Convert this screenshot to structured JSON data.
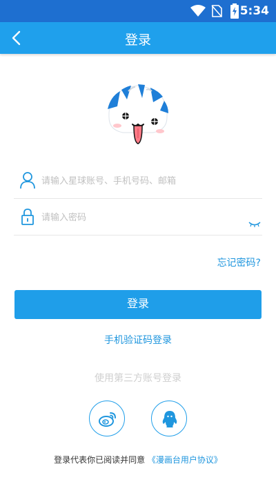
{
  "status_bar": {
    "time": "5:34"
  },
  "app_bar": {
    "title": "登录"
  },
  "form": {
    "account_placeholder": "请输入星球账号、手机号码、邮箱",
    "password_placeholder": "请输入密码",
    "forgot_label": "忘记密码?",
    "login_label": "登录",
    "sms_login_label": "手机验证码登录"
  },
  "third_party": {
    "label": "使用第三方账号登录"
  },
  "agreement": {
    "text": "登录代表你已阅读并同意",
    "link": "《漫画台用户协议》"
  },
  "colors": {
    "status_bar": "#1e6fd0",
    "app_bar": "#1fa0ec",
    "accent": "#1f96de"
  }
}
